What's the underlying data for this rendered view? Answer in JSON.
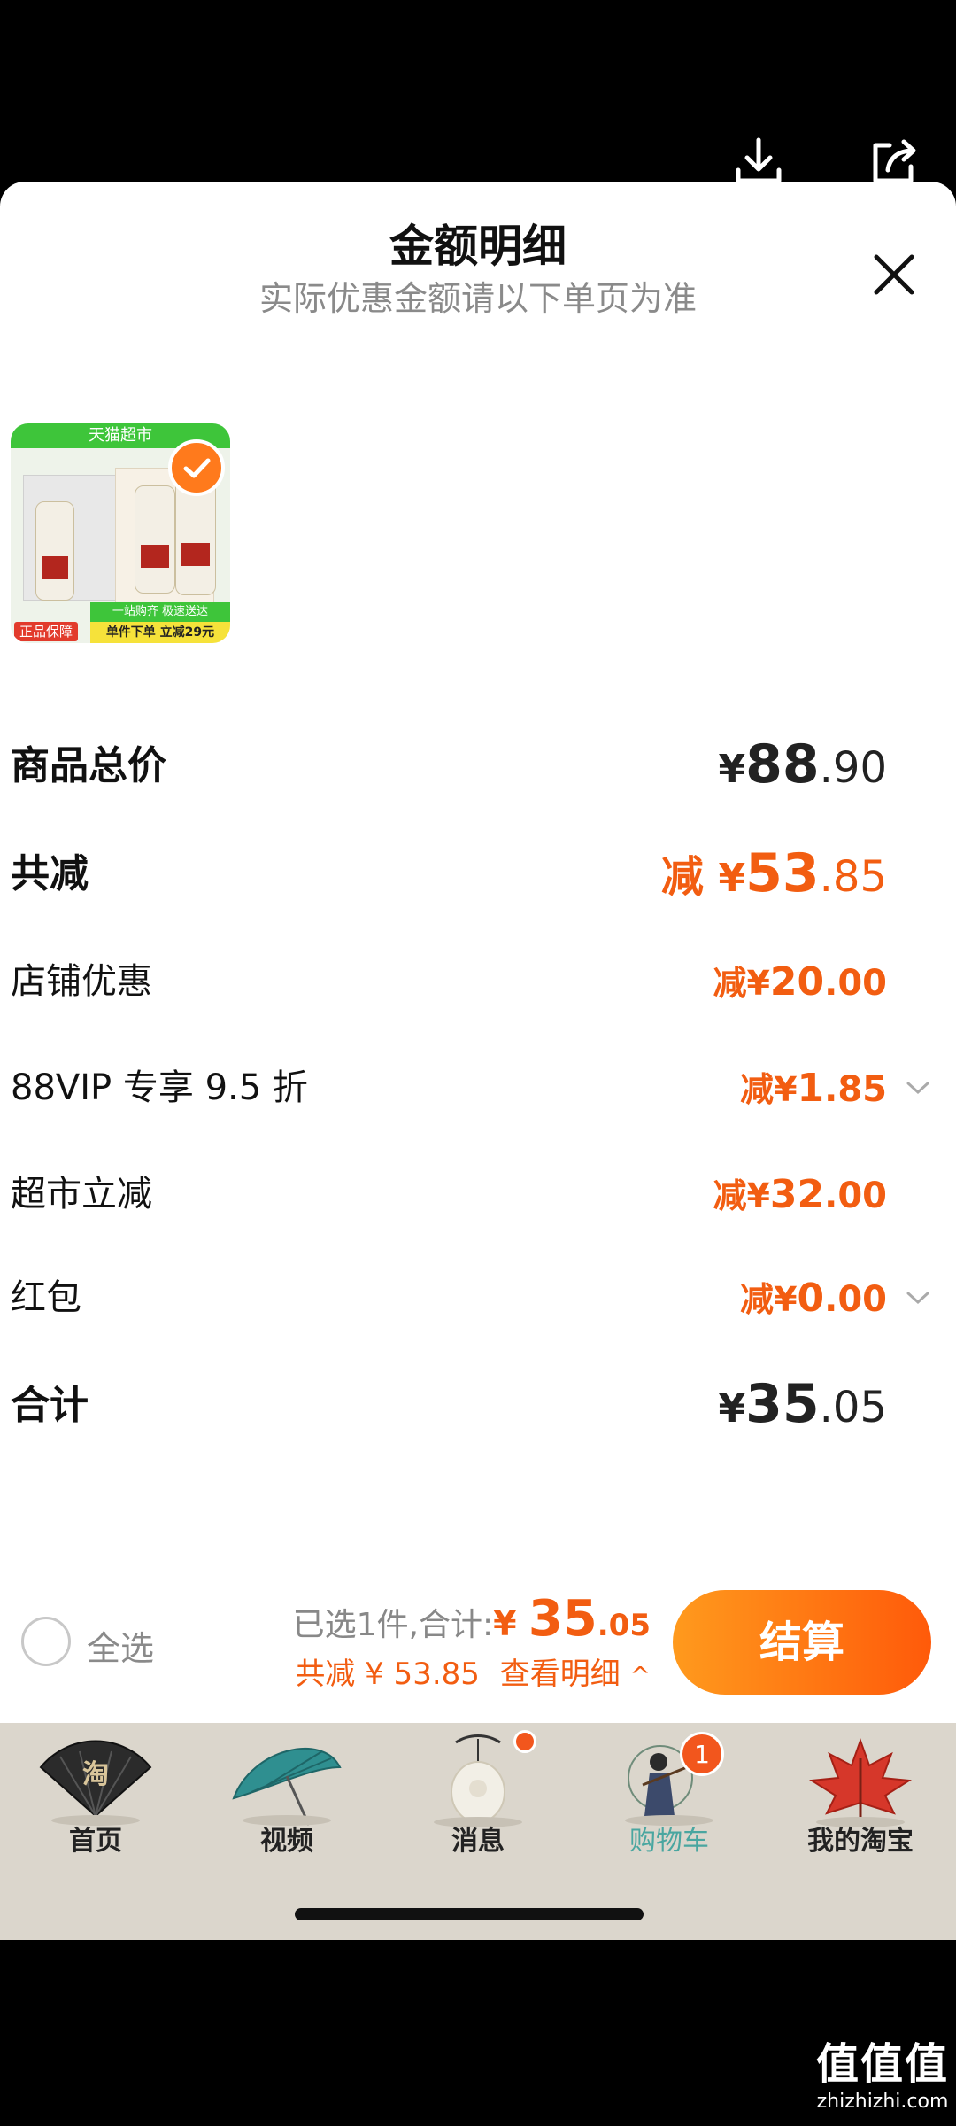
{
  "header": {
    "title": "金额明细",
    "subtitle": "实际优惠金额请以下单页为准"
  },
  "product": {
    "shop_tag": "天猫超市",
    "guarantee": "正品保障",
    "promo_top": "一站购齐 极速送达",
    "promo": "单件下单 立减29元"
  },
  "rows": [
    {
      "label": "商品总价",
      "currency": "¥",
      "int": "88",
      "dec": ".90",
      "style": "total"
    },
    {
      "label": "共减",
      "prefix": "减 ",
      "currency": "¥",
      "int": "53",
      "dec": ".85",
      "style": "discount_total"
    },
    {
      "label": "店铺优惠",
      "prefix": "减",
      "currency": "¥",
      "int": "20",
      "dec": ".00",
      "style": "discount"
    },
    {
      "label": "88VIP 专享 9.5 折",
      "prefix": "减",
      "currency": "¥",
      "int": "1",
      "dec": ".85",
      "style": "discount",
      "expandable": true
    },
    {
      "label": "超市立减",
      "prefix": "减",
      "currency": "¥",
      "int": "32",
      "dec": ".00",
      "style": "discount"
    },
    {
      "label": "红包",
      "prefix": "减",
      "currency": "¥",
      "int": "0",
      "dec": ".00",
      "style": "discount",
      "expandable": true
    },
    {
      "label": "合计",
      "currency": "¥",
      "int": "35",
      "dec": ".05",
      "style": "total"
    }
  ],
  "footer": {
    "select_all": "全选",
    "selected_text": "已选1件,合计:",
    "total_currency": "¥ ",
    "total_int": "35",
    "total_dec": ".05",
    "discount_text": "共减 ¥ 53.85",
    "detail_link": "查看明细",
    "detail_arrow": "^",
    "checkout": "结算"
  },
  "tabs": [
    {
      "label": "首页",
      "icon": "folding-fan-icon"
    },
    {
      "label": "视频",
      "icon": "umbrella-icon"
    },
    {
      "label": "消息",
      "icon": "jade-pendant-icon"
    },
    {
      "label": "购物车",
      "icon": "warrior-icon",
      "active": true,
      "badge": "1"
    },
    {
      "label": "我的淘宝",
      "icon": "maple-leaf-icon"
    }
  ],
  "watermark": {
    "line1": "值值值",
    "line2": "zhizhizhi.com"
  },
  "colors": {
    "accent": "#f25d11",
    "active_tab": "#4aa6a0",
    "tabbar_bg": "#dbd6cc"
  }
}
